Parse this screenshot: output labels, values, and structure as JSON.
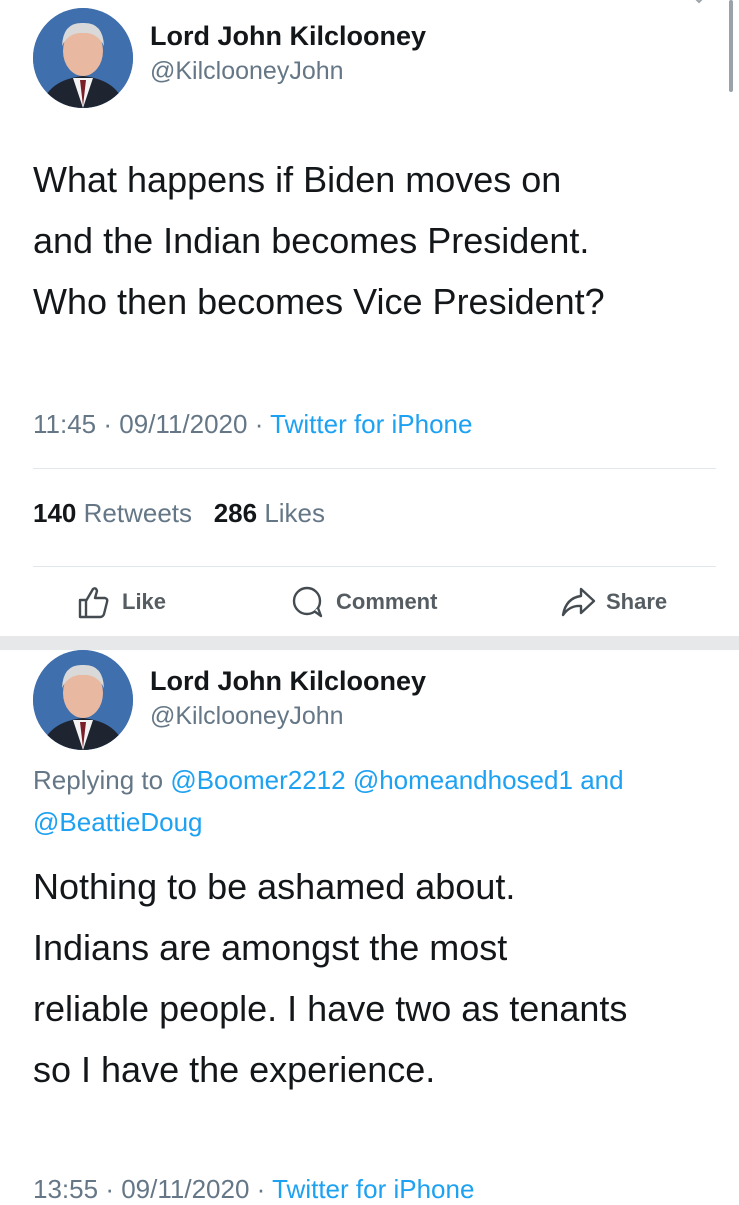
{
  "tweets": [
    {
      "name": "Lord John Kilclooney",
      "handle": "@KilclooneyJohn",
      "lines": [
        "What happens if Biden moves on",
        "and the Indian becomes President.",
        "Who then becomes Vice President?"
      ],
      "time": "11:45",
      "date": "09/11/2020",
      "source": "Twitter for iPhone",
      "retweets_count": "140",
      "retweets_label": "Retweets",
      "likes_count": "286",
      "likes_label": "Likes"
    },
    {
      "name": "Lord John Kilclooney",
      "handle": "@KilclooneyJohn",
      "replying_prefix": "Replying to",
      "mentions": [
        "@Boomer2212",
        "@homeandhosed1",
        "@BeattieDoug"
      ],
      "mentions_and": "and",
      "lines": [
        "Nothing to be ashamed about.",
        "Indians are amongst the most",
        "reliable people. I have two as tenants",
        "so I have the experience."
      ],
      "time": "13:55",
      "date": "09/11/2020",
      "source": "Twitter for iPhone"
    }
  ],
  "actions": {
    "like": "Like",
    "comment": "Comment",
    "share": "Share"
  },
  "meta_separator": "·",
  "colors": {
    "link": "#1da1f2",
    "secondary": "#657786",
    "text": "#14171a",
    "divider": "#e1e8ed",
    "separator_band": "#e6e8ea"
  }
}
